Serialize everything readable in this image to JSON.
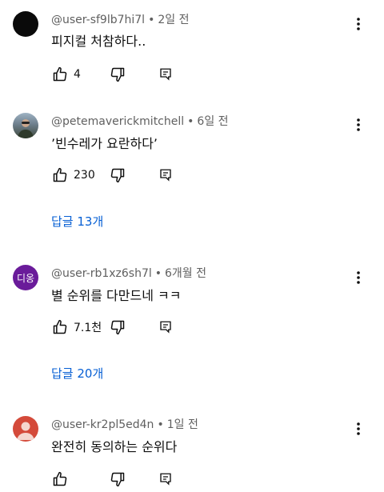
{
  "comments": [
    {
      "author": "@user-sf9lb7hi7l",
      "sep": "•",
      "time": "2일 전",
      "text": "피지컬 처참하다..",
      "likes": "4",
      "avatar_style": "black"
    },
    {
      "author": "@petemaverickmitchell",
      "sep": "•",
      "time": "6일 전",
      "text": "’빈수레가 요란하다’",
      "likes": "230",
      "replies": "답글 13개",
      "avatar_style": "photo"
    },
    {
      "author": "@user-rb1xz6sh7l",
      "sep": "•",
      "time": "6개월 전",
      "text": "별 순위를 다만드네 ㅋㅋ",
      "likes": "7.1천",
      "replies": "답글 20개",
      "avatar_style": "letters",
      "avatar_text": "디옹"
    },
    {
      "author": "@user-kr2pl5ed4n",
      "sep": "•",
      "time": "1일 전",
      "text": "완전히 동의하는 순위다",
      "likes": "",
      "avatar_style": "default-red"
    }
  ],
  "colors": {
    "link": "#065fd4",
    "meta": "#606060",
    "text": "#0f0f0f"
  },
  "icons": [
    "thumbs-up-icon",
    "thumbs-down-icon",
    "reply-icon",
    "more-vertical-icon"
  ]
}
